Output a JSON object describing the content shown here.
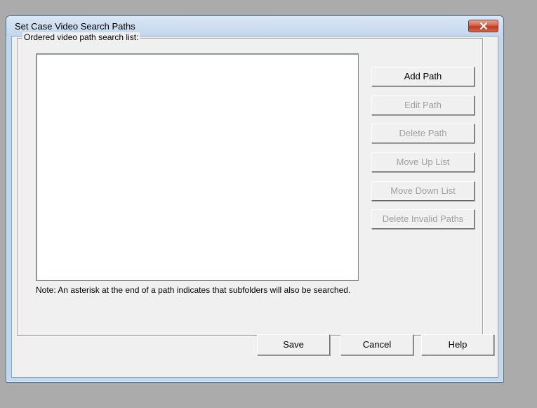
{
  "window": {
    "title": "Set Case Video Search Paths"
  },
  "group": {
    "label": "Ordered video path search list:"
  },
  "list": {
    "items": []
  },
  "buttons": {
    "add_path": "Add Path",
    "edit_path": "Edit Path",
    "delete_path": "Delete Path",
    "move_up": "Move Up List",
    "move_down": "Move Down List",
    "delete_invalid": "Delete Invalid Paths"
  },
  "note": "Note: An asterisk at the end of a path indicates that subfolders will also be searched.",
  "footer": {
    "save": "Save",
    "cancel": "Cancel",
    "help": "Help"
  },
  "colors": {
    "desktop": "#ababab",
    "frame": "#c3d7ec",
    "close_button": "#c0391f",
    "disabled_text": "#a0a0a0"
  },
  "icons": {
    "close": "close-x-icon"
  }
}
